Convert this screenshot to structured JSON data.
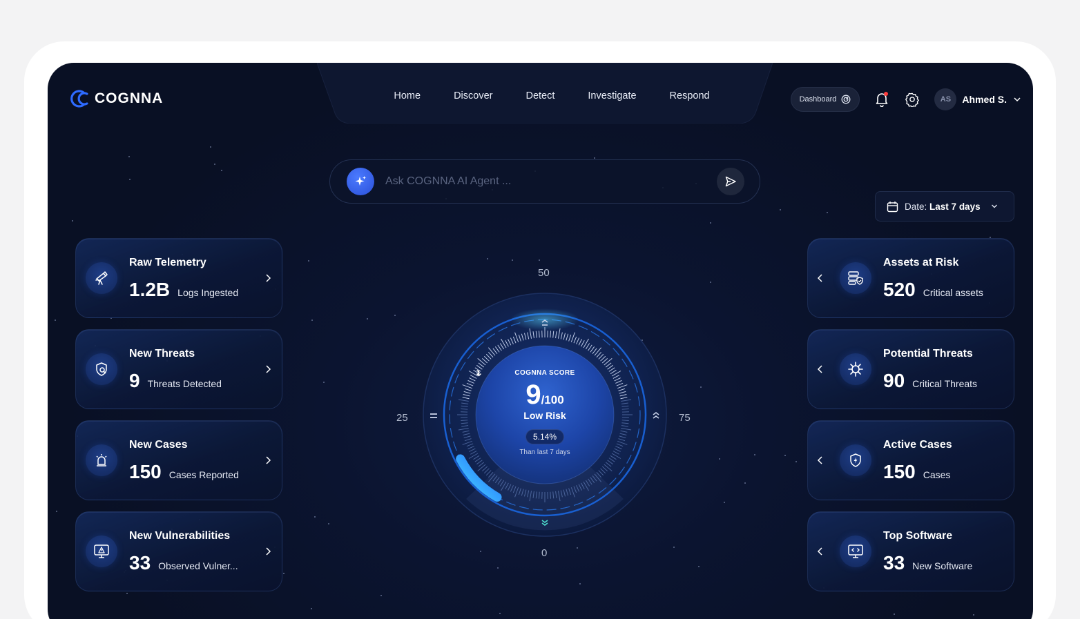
{
  "brand": {
    "name": "COGNNA"
  },
  "nav": {
    "items": [
      {
        "label": "Home"
      },
      {
        "label": "Discover"
      },
      {
        "label": "Detect"
      },
      {
        "label": "Investigate"
      },
      {
        "label": "Respond"
      }
    ]
  },
  "header": {
    "dashboard_label": "Dashboard",
    "user": {
      "initials": "AS",
      "name": "Ahmed S."
    },
    "notification_dot_color": "#ff3d3d"
  },
  "search": {
    "placeholder": "Ask COGNNA AI Agent ..."
  },
  "date_filter": {
    "prefix": "Date:",
    "value": "Last 7 days"
  },
  "left_cards": [
    {
      "title": "Raw Telemetry",
      "value": "1.2B",
      "subtitle": "Logs Ingested",
      "icon": "telescope-icon"
    },
    {
      "title": "New Threats",
      "value": "9",
      "subtitle": "Threats Detected",
      "icon": "shield-search-icon"
    },
    {
      "title": "New Cases",
      "value": "150",
      "subtitle": "Cases Reported",
      "icon": "siren-icon"
    },
    {
      "title": "New Vulnerabilities",
      "value": "33",
      "subtitle": "Observed Vulner...",
      "icon": "monitor-warning-icon"
    }
  ],
  "right_cards": [
    {
      "title": "Assets at Risk",
      "value": "520",
      "subtitle": "Critical assets",
      "icon": "server-shield-icon"
    },
    {
      "title": "Potential Threats",
      "value": "90",
      "subtitle": "Critical Threats",
      "icon": "virus-icon"
    },
    {
      "title": "Active Cases",
      "value": "150",
      "subtitle": "Cases",
      "icon": "shield-bolt-icon"
    },
    {
      "title": "Top Software",
      "value": "33",
      "subtitle": "New Software",
      "icon": "monitor-code-icon"
    }
  ],
  "score": {
    "caption": "COGNNA SCORE",
    "value": "9",
    "max": "/100",
    "value_num": 9,
    "risk": "Low Risk",
    "trend": "5.14%",
    "trend_direction": "down",
    "trend_note": "Than last 7 days",
    "scale": {
      "top": "50",
      "left": "25",
      "right": "75",
      "bottom": "0"
    }
  },
  "colors": {
    "accent": "#2a4fd8",
    "arc": "#2b8fff",
    "background": "#0b1430"
  }
}
